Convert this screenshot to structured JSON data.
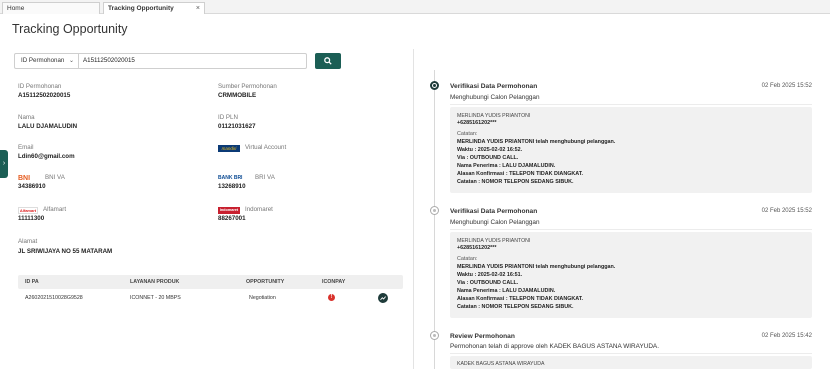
{
  "tabs": [
    {
      "label": "Home",
      "active": false
    },
    {
      "label": "Tracking Opportunity",
      "active": true,
      "close": "×"
    }
  ],
  "page_title": "Tracking Opportunity",
  "search": {
    "type_label": "ID Permohonan",
    "value": "A15112502020015",
    "button_icon": "search-icon"
  },
  "fields": {
    "id_permohonan": {
      "label": "ID Permohonan",
      "value": "A15112502020015"
    },
    "sumber_permohonan": {
      "label": "Sumber Permohonan",
      "value": "CRMMOBILE"
    },
    "nama": {
      "label": "Nama",
      "value": "LALU DJAMALUDIN"
    },
    "id_pln": {
      "label": "ID PLN",
      "value": "01121031627"
    },
    "email": {
      "label": "Email",
      "value": "Ldin60@gmail.com"
    },
    "virtual_account": {
      "label": "Virtual Account",
      "logo_text": "mandiri"
    },
    "bni_va": {
      "label": "BNI VA",
      "logo_text": "BNI",
      "value": "34386910"
    },
    "bri_va": {
      "label": "BRI VA",
      "logo_text": "BANK BRI",
      "value": "13268910"
    },
    "alfamart": {
      "label": "Alfamart",
      "logo_text": "Alfamart",
      "value": "11111300"
    },
    "indomaret": {
      "label": "Indomaret",
      "logo_text": "Indomaret",
      "value": "88267001"
    },
    "alamat": {
      "label": "Alamat",
      "value": "JL SRIWIJAYA NO 55 MATARAM"
    }
  },
  "table": {
    "headers": [
      "ID PA",
      "LAYANAN PRODUK",
      "OPPORTUNITY",
      "ICONPAY"
    ],
    "rows": [
      {
        "id_pa": "A2602021510028G9528",
        "layanan": "ICONNET - 20 MBPS",
        "opportunity": "Negotiation",
        "iconpay_status": "!",
        "action_icon": "trend-up-icon"
      }
    ]
  },
  "timeline": [
    {
      "title": "Verifikasi Data Permohonan",
      "date": "02 Feb 2025 15:52",
      "subtitle": "Menghubungi Calon Pelanggan",
      "agent": "MERLINDA YUDIS PRIANTONI",
      "phone": "+6285161202***",
      "catatan_label": "Catatan:",
      "lines": [
        "MERLINDA YUDIS PRIANTONI telah menghubungi pelanggan.",
        "Waktu : 2025-02-02 16:52.",
        "Via : OUTBOUND CALL.",
        "Nama Penerima : LALU DJAMALUDIN.",
        "Alasan Konfirmasi : TELEPON TIDAK DIANGKAT.",
        "Catatan : NOMOR TELEPON SEDANG SIBUK."
      ]
    },
    {
      "title": "Verifikasi Data Permohonan",
      "date": "02 Feb 2025 15:52",
      "subtitle": "Menghubungi Calon Pelanggan",
      "agent": "MERLINDA YUDIS PRIANTONI",
      "phone": "+6285161202***",
      "catatan_label": "Catatan:",
      "lines": [
        "MERLINDA YUDIS PRIANTONI telah menghubungi pelanggan.",
        "Waktu : 2025-02-02 16:51.",
        "Via : OUTBOUND CALL.",
        "Nama Penerima : LALU DJAMALUDIN.",
        "Alasan Konfirmasi : TELEPON TIDAK DIANGKAT.",
        "Catatan : NOMOR TELEPON SEDANG SIBUK."
      ]
    },
    {
      "title": "Review Permohonan",
      "date": "02 Feb 2025 15:42",
      "subtitle": "Permohonan telah di approve oleh KADEK BAGUS ASTANA WIRAYUDA.",
      "agent": "KADEK BAGUS ASTANA WIRAYUDA"
    }
  ],
  "colors": {
    "primary": "#1b5e55",
    "danger": "#d9322c",
    "card_bg": "#f1f1f1"
  }
}
